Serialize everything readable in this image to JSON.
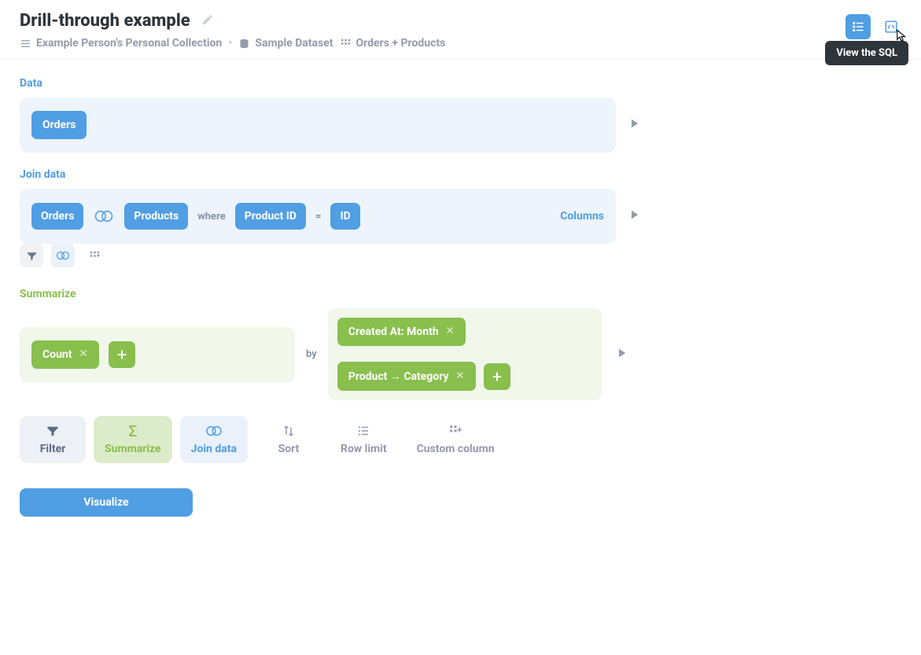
{
  "header": {
    "title": "Drill-through example",
    "crumbs": {
      "collection": "Example Person's Personal Collection",
      "database": "Sample Dataset",
      "table": "Orders + Products"
    },
    "tooltip": "View the SQL"
  },
  "sections": {
    "data_label": "Data",
    "data_table": "Orders",
    "join_label": "Join data",
    "join": {
      "left": "Orders",
      "right": "Products",
      "where": "where",
      "left_col": "Product ID",
      "eq": "=",
      "right_col": "ID",
      "columns": "Columns"
    },
    "summarize_label": "Summarize",
    "summarize": {
      "aggregation": "Count",
      "by": "by",
      "dims": [
        "Created At: Month",
        "Product → Category"
      ]
    }
  },
  "actions": {
    "filter": "Filter",
    "summarize": "Summarize",
    "join": "Join data",
    "sort": "Sort",
    "rowlimit": "Row limit",
    "custom": "Custom column"
  },
  "visualize": "Visualize"
}
